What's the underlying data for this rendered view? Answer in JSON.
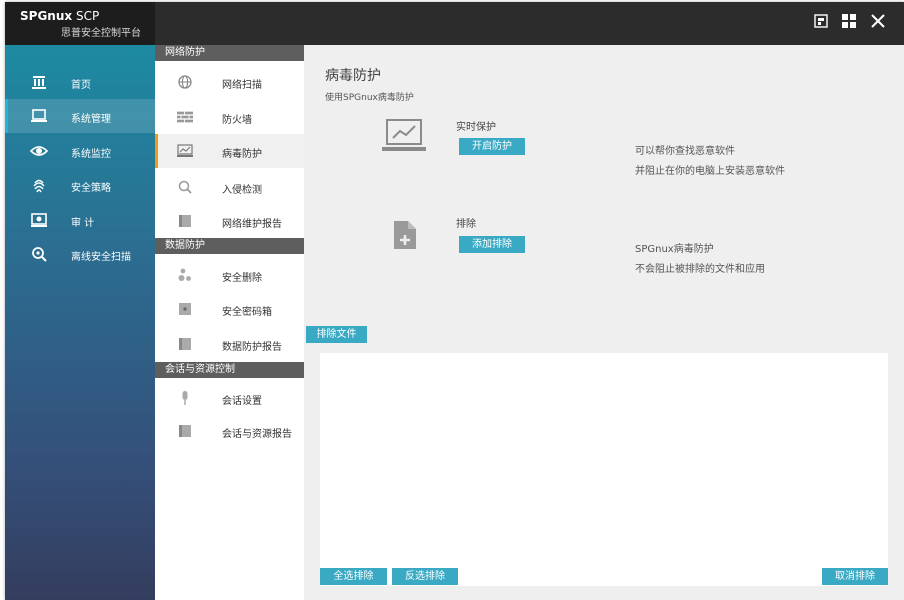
{
  "app": {
    "name_bold": "SPGnux",
    "name_rest": "SCP",
    "subtitle": "思普安全控制平台"
  },
  "window_controls": {
    "restore_icon": "window-restore-icon",
    "grid_icon": "grid-icon",
    "close_icon": "close-icon"
  },
  "left_nav": {
    "items": [
      {
        "label": "首页",
        "icon": "home-icon"
      },
      {
        "label": "系统管理",
        "icon": "laptop-icon",
        "active": true
      },
      {
        "label": "系统监控",
        "icon": "eye-icon"
      },
      {
        "label": "安全策略",
        "icon": "fingerprint-icon"
      },
      {
        "label": "审 计",
        "icon": "audit-icon"
      },
      {
        "label": "离线安全扫描",
        "icon": "scan-icon"
      }
    ]
  },
  "sub_menu": {
    "sections": [
      {
        "title": "网络防护",
        "items": [
          {
            "label": "网络扫描",
            "icon": "globe-icon"
          },
          {
            "label": "防火墙",
            "icon": "brick-wall-icon"
          },
          {
            "label": "病毒防护",
            "icon": "monitor-chart-icon",
            "active": true
          },
          {
            "label": "入侵检测",
            "icon": "magnifier-icon"
          }
        ]
      }
    ],
    "report_1": "网络维护报告",
    "section_2_title": "数据防护",
    "delete": "安全删除",
    "vault": "安全密码箱",
    "report_2": "数据防护报告",
    "section_3_title": "会话与资源控制",
    "session": "会话设置",
    "report_3": "会话与资源报告"
  },
  "content": {
    "title": "病毒防护",
    "subtitle": "使用SPGnux病毒防护",
    "realtime": {
      "icon": "laptop-chart-icon",
      "label": "实时保护",
      "button": "开启防护",
      "desc_line1": "可以帮你查找恶意软件",
      "desc_line2": "并阻止在你的电脑上安装恶意软件"
    },
    "exclusion": {
      "icon": "file-add-icon",
      "label": "排除",
      "button": "添加排除",
      "desc_line1": "SPGnux病毒防护",
      "desc_line2": "不会阻止被排除的文件和应用"
    },
    "exclude_files_tab": "排除文件",
    "select_all": "全选排除",
    "invert_select": "反选排除",
    "cancel_exclude": "取消排除"
  },
  "colors": {
    "accent": "#3aa9c4",
    "active_marker": "#f39c12",
    "topbar": "#2c2c2c"
  }
}
